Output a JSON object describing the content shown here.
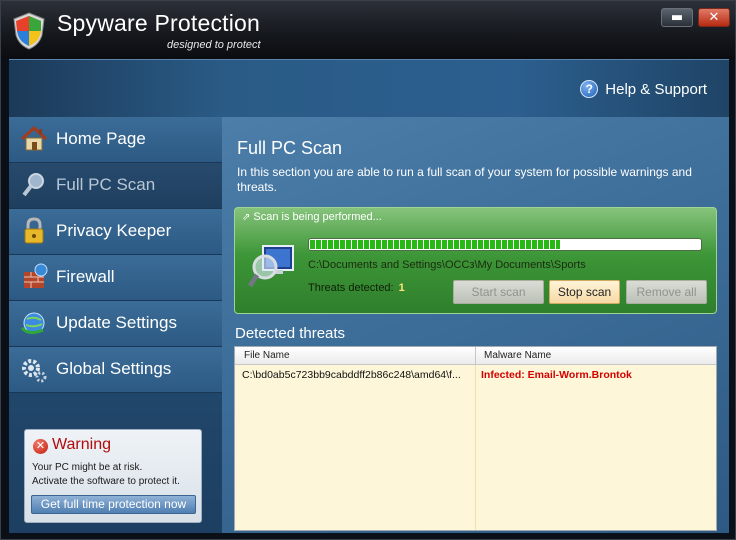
{
  "window": {
    "title": "Spyware Protection",
    "subtitle": "designed to protect",
    "minimize_glyph": "▬",
    "close_glyph": "✕"
  },
  "header": {
    "help_label": "Help & Support",
    "help_glyph": "?"
  },
  "sidebar": {
    "items": [
      {
        "label": "Home Page",
        "icon": "house-icon",
        "active": false
      },
      {
        "label": "Full PC Scan",
        "icon": "magnifier-icon",
        "active": true
      },
      {
        "label": "Privacy Keeper",
        "icon": "padlock-icon",
        "active": false
      },
      {
        "label": "Firewall",
        "icon": "firewall-icon",
        "active": false
      },
      {
        "label": "Update Settings",
        "icon": "globe-update-icon",
        "active": false
      },
      {
        "label": "Global Settings",
        "icon": "gears-icon",
        "active": false
      }
    ],
    "warning": {
      "title": "Warning",
      "line1": "Your PC might be at risk.",
      "line2": "Activate the software to protect it.",
      "button": "Get full time protection now",
      "glyph": "✕"
    }
  },
  "main": {
    "title": "Full PC Scan",
    "description": "In this section you are able to run a full scan of your system for possible warnings and threats.",
    "scan": {
      "status": "Scan is being performed...",
      "progress": 0.64,
      "current_path": "C:\\Documents and Settings\\OCCз\\My Documents\\Sports",
      "threats_label": "Threats detected:",
      "threats_count": "1",
      "start_button": "Start scan",
      "stop_button": "Stop scan",
      "remove_button": "Remove all"
    },
    "detected": {
      "title": "Detected threats",
      "columns": [
        "File Name",
        "Malware Name"
      ],
      "rows": [
        {
          "file": "C:\\bd0ab5c723bb9cabddff2b86c248\\amd64\\f...",
          "malware": "Infected: Email-Worm.Brontok"
        }
      ]
    }
  },
  "colors": {
    "accent_blue": "#2c5f8f",
    "scan_green": "#3d9637",
    "progress_green": "#28b816",
    "threat_red": "#d40000"
  }
}
